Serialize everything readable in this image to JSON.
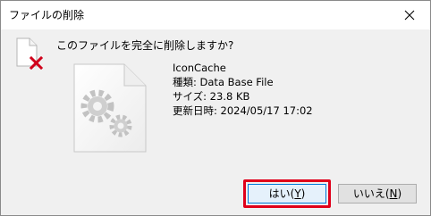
{
  "window": {
    "title": "ファイルの削除",
    "close_icon": "close-icon"
  },
  "message": {
    "question": "このファイルを完全に削除しますか?"
  },
  "file": {
    "name": "IconCache",
    "type_line": "種類: Data Base File",
    "size_line": "サイズ: 23.8 KB",
    "modified_line": "更新日時: 2024/05/17 17:02",
    "icon": "settings-file-icon",
    "delete_badge_icon": "red-x-icon"
  },
  "buttons": {
    "yes_label": "はい",
    "yes_accel_prefix": "(",
    "yes_accel": "Y",
    "yes_accel_suffix": ")",
    "no_label": "いいえ",
    "no_accel_prefix": "(",
    "no_accel": "N",
    "no_accel_suffix": ")"
  },
  "colors": {
    "highlight": "#e0001a",
    "default_button_border": "#0078d7",
    "dialog_background": "#f0f0f0",
    "delete_x": "#d0021b"
  }
}
